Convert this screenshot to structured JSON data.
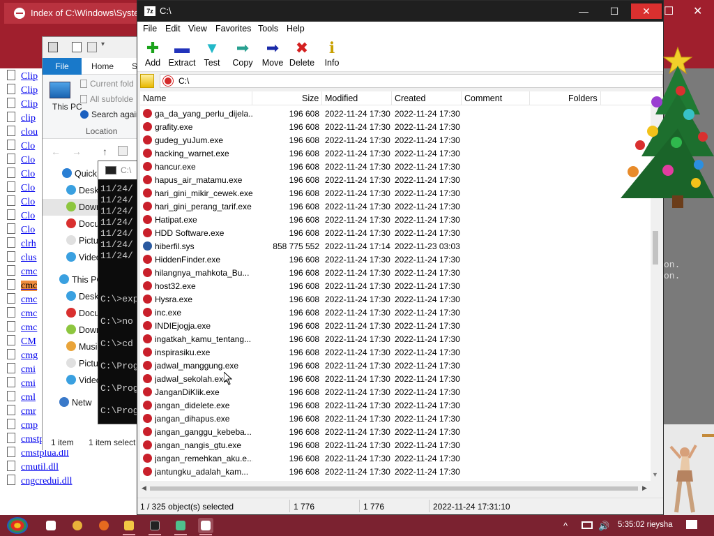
{
  "browser": {
    "tab_title": "Index of C:\\Windows\\System32",
    "bookmark_1": "Sa",
    "win_min": "—",
    "win_max": "☐",
    "win_close": "✕",
    "dir_items": [
      "Clip",
      "Clip",
      "Clip",
      "clip",
      "clou",
      "Clo",
      "Clo",
      "Clo",
      "Clo",
      "Clo",
      "Clo",
      "Clo",
      "clrh",
      "clus",
      "cmc",
      "cmc",
      "cmc",
      "cmc",
      "cmc",
      "CM",
      "cmg",
      "cmi",
      "cmi",
      "cml",
      "cmr",
      "cmp",
      "cmstp.exe",
      "cmstplua.dll",
      "cmutil.dll",
      "cngcredui.dll"
    ],
    "highlighted_index": 15,
    "side_text": [
      "on.",
      "on."
    ]
  },
  "explorer": {
    "tab_file": "File",
    "tab_home": "Home",
    "tab_more": "S",
    "ribbon_this_pc": "This PC",
    "ribbon_current_folder": "Current fold",
    "ribbon_all_subfolders": "All subfolde",
    "ribbon_search_again": "Search again",
    "ribbon_location": "Location",
    "nav_items": [
      {
        "label": "Quick",
        "icon": "star-icon",
        "color": "#2a7fd4"
      },
      {
        "label": "Deskt",
        "icon": "desktop-icon",
        "color": "#3aa0e0"
      },
      {
        "label": "Down",
        "icon": "downloads-icon",
        "color": "#8dc63f"
      },
      {
        "label": "Docu",
        "icon": "documents-icon",
        "color": "#d9302f"
      },
      {
        "label": "Pictu",
        "icon": "pictures-icon",
        "color": "#e0e0e0"
      },
      {
        "label": "Video",
        "icon": "videos-icon",
        "color": "#3aa0e0"
      },
      {
        "label": "This PC",
        "icon": "this-pc-icon",
        "color": "#3aa0e0"
      },
      {
        "label": "Deskt",
        "icon": "desktop-icon",
        "color": "#3aa0e0"
      },
      {
        "label": "Docu",
        "icon": "documents-icon",
        "color": "#d9302f"
      },
      {
        "label": "Down",
        "icon": "downloads-icon",
        "color": "#8dc63f"
      },
      {
        "label": "Music",
        "icon": "music-icon",
        "color": "#e9a43a"
      },
      {
        "label": "Pictu",
        "icon": "pictures-icon",
        "color": "#e0e0e0"
      },
      {
        "label": "Video",
        "icon": "videos-icon",
        "color": "#3aa0e0"
      },
      {
        "label": "Netw",
        "icon": "network-icon",
        "color": "#3a79c9"
      }
    ],
    "status_count": "1 item",
    "status_selected": "1 item select"
  },
  "cmd": {
    "title": "C:\\",
    "lines": [
      "11/24/",
      "11/24/",
      "11/24/",
      "11/24/",
      "11/24/",
      "11/24/",
      "11/24/",
      "C:\\>exp",
      "C:\\>no",
      "C:\\>cd",
      "C:\\Prog",
      "C:\\Prog",
      "C:\\Prog"
    ]
  },
  "zip": {
    "app_badge": "7z",
    "title": "C:\\",
    "menu": [
      "File",
      "Edit",
      "View",
      "Favorites",
      "Tools",
      "Help"
    ],
    "toolbar": [
      {
        "label": "Add",
        "glyph": "✚",
        "color": "#1aa31a",
        "icon": "add-icon"
      },
      {
        "label": "Extract",
        "glyph": "▬",
        "color": "#2233bb",
        "icon": "extract-icon"
      },
      {
        "label": "Test",
        "glyph": "▼",
        "color": "#22b8c8",
        "icon": "test-icon"
      },
      {
        "label": "Copy",
        "glyph": "➡",
        "color": "#28a090",
        "icon": "copy-icon"
      },
      {
        "label": "Move",
        "glyph": "➡",
        "color": "#1a2aa8",
        "icon": "move-icon"
      },
      {
        "label": "Delete",
        "glyph": "✖",
        "color": "#d42020",
        "icon": "delete-icon"
      },
      {
        "label": "Info",
        "glyph": "ℹ",
        "color": "#c8a000",
        "icon": "info-icon"
      }
    ],
    "path": "C:\\",
    "columns": {
      "name": "Name",
      "size": "Size",
      "modified": "Modified",
      "created": "Created",
      "comment": "Comment",
      "folders": "Folders"
    },
    "rows": [
      {
        "name": "ga_da_yang_perlu_dijela...",
        "size": "196 608",
        "modified": "2022-11-24 17:30",
        "created": "2022-11-24 17:30",
        "icon": "exe"
      },
      {
        "name": "grafity.exe",
        "size": "196 608",
        "modified": "2022-11-24 17:30",
        "created": "2022-11-24 17:30",
        "icon": "exe"
      },
      {
        "name": "gudeg_yuJum.exe",
        "size": "196 608",
        "modified": "2022-11-24 17:30",
        "created": "2022-11-24 17:30",
        "icon": "exe"
      },
      {
        "name": "hacking_warnet.exe",
        "size": "196 608",
        "modified": "2022-11-24 17:30",
        "created": "2022-11-24 17:30",
        "icon": "exe"
      },
      {
        "name": "hancur.exe",
        "size": "196 608",
        "modified": "2022-11-24 17:30",
        "created": "2022-11-24 17:30",
        "icon": "exe"
      },
      {
        "name": "hapus_air_matamu.exe",
        "size": "196 608",
        "modified": "2022-11-24 17:30",
        "created": "2022-11-24 17:30",
        "icon": "exe"
      },
      {
        "name": "hari_gini_mikir_cewek.exe",
        "size": "196 608",
        "modified": "2022-11-24 17:30",
        "created": "2022-11-24 17:30",
        "icon": "exe"
      },
      {
        "name": "hari_gini_perang_tarif.exe",
        "size": "196 608",
        "modified": "2022-11-24 17:30",
        "created": "2022-11-24 17:30",
        "icon": "exe"
      },
      {
        "name": "Hatipat.exe",
        "size": "196 608",
        "modified": "2022-11-24 17:30",
        "created": "2022-11-24 17:30",
        "icon": "exe"
      },
      {
        "name": "HDD Software.exe",
        "size": "196 608",
        "modified": "2022-11-24 17:30",
        "created": "2022-11-24 17:30",
        "icon": "exe"
      },
      {
        "name": "hiberfil.sys",
        "size": "858 775 552",
        "modified": "2022-11-24 17:14",
        "created": "2022-11-23 03:03",
        "icon": "sys"
      },
      {
        "name": "HiddenFinder.exe",
        "size": "196 608",
        "modified": "2022-11-24 17:30",
        "created": "2022-11-24 17:30",
        "icon": "exe"
      },
      {
        "name": "hilangnya_mahkota_Bu...",
        "size": "196 608",
        "modified": "2022-11-24 17:30",
        "created": "2022-11-24 17:30",
        "icon": "exe"
      },
      {
        "name": "host32.exe",
        "size": "196 608",
        "modified": "2022-11-24 17:30",
        "created": "2022-11-24 17:30",
        "icon": "exe"
      },
      {
        "name": "Hysra.exe",
        "size": "196 608",
        "modified": "2022-11-24 17:30",
        "created": "2022-11-24 17:30",
        "icon": "exe"
      },
      {
        "name": "inc.exe",
        "size": "196 608",
        "modified": "2022-11-24 17:30",
        "created": "2022-11-24 17:30",
        "icon": "exe"
      },
      {
        "name": "INDIEjogja.exe",
        "size": "196 608",
        "modified": "2022-11-24 17:30",
        "created": "2022-11-24 17:30",
        "icon": "exe"
      },
      {
        "name": "ingatkah_kamu_tentang...",
        "size": "196 608",
        "modified": "2022-11-24 17:30",
        "created": "2022-11-24 17:30",
        "icon": "exe"
      },
      {
        "name": "inspirasiku.exe",
        "size": "196 608",
        "modified": "2022-11-24 17:30",
        "created": "2022-11-24 17:30",
        "icon": "exe"
      },
      {
        "name": "jadwal_manggung.exe",
        "size": "196 608",
        "modified": "2022-11-24 17:30",
        "created": "2022-11-24 17:30",
        "icon": "exe"
      },
      {
        "name": "jadwal_sekolah.exe",
        "size": "196 608",
        "modified": "2022-11-24 17:30",
        "created": "2022-11-24 17:30",
        "icon": "exe"
      },
      {
        "name": "JanganDiKlik.exe",
        "size": "196 608",
        "modified": "2022-11-24 17:30",
        "created": "2022-11-24 17:30",
        "icon": "exe"
      },
      {
        "name": "jangan_didelete.exe",
        "size": "196 608",
        "modified": "2022-11-24 17:30",
        "created": "2022-11-24 17:30",
        "icon": "exe"
      },
      {
        "name": "jangan_dihapus.exe",
        "size": "196 608",
        "modified": "2022-11-24 17:30",
        "created": "2022-11-24 17:30",
        "icon": "exe"
      },
      {
        "name": "jangan_ganggu_kebeba...",
        "size": "196 608",
        "modified": "2022-11-24 17:30",
        "created": "2022-11-24 17:30",
        "icon": "exe"
      },
      {
        "name": "jangan_nangis_gtu.exe",
        "size": "196 608",
        "modified": "2022-11-24 17:30",
        "created": "2022-11-24 17:30",
        "icon": "exe"
      },
      {
        "name": "jangan_remehkan_aku.e...",
        "size": "196 608",
        "modified": "2022-11-24 17:30",
        "created": "2022-11-24 17:30",
        "icon": "exe"
      },
      {
        "name": "jantungku_adalah_kam...",
        "size": "196 608",
        "modified": "2022-11-24 17:30",
        "created": "2022-11-24 17:30",
        "icon": "exe"
      }
    ],
    "status": {
      "selection": "1 / 325 object(s) selected",
      "size": "1 776",
      "packed": "1 776",
      "time": "2022-11-24 17:31:10"
    }
  },
  "taskbar": {
    "apps": [
      {
        "icon": "task-view-icon",
        "color": "#ffffff"
      },
      {
        "icon": "chrome-icon",
        "color": "#e8b23a"
      },
      {
        "icon": "firefox-icon",
        "color": "#e66a1f"
      },
      {
        "icon": "file-explorer-icon",
        "color": "#f2c744"
      },
      {
        "icon": "cmd-icon",
        "color": "#222222"
      },
      {
        "icon": "notepad-icon",
        "color": "#4fc08d"
      },
      {
        "icon": "7zip-icon",
        "color": "#ffffff"
      }
    ],
    "clock": "5:35:02 rieysha",
    "tray_up": "^",
    "speaker": "🔊"
  }
}
